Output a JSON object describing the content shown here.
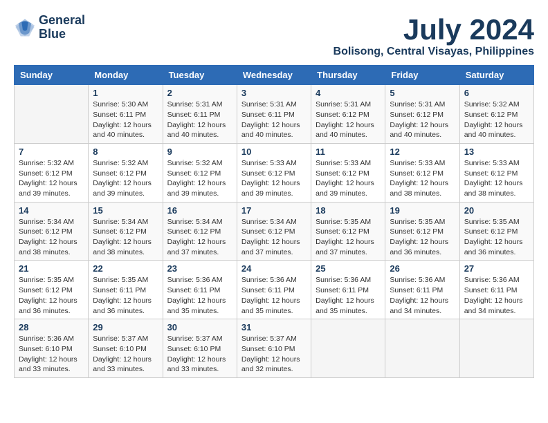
{
  "logo": {
    "line1": "General",
    "line2": "Blue"
  },
  "title": "July 2024",
  "location": "Bolisong, Central Visayas, Philippines",
  "weekdays": [
    "Sunday",
    "Monday",
    "Tuesday",
    "Wednesday",
    "Thursday",
    "Friday",
    "Saturday"
  ],
  "weeks": [
    [
      {
        "day": "",
        "info": ""
      },
      {
        "day": "1",
        "info": "Sunrise: 5:30 AM\nSunset: 6:11 PM\nDaylight: 12 hours\nand 40 minutes."
      },
      {
        "day": "2",
        "info": "Sunrise: 5:31 AM\nSunset: 6:11 PM\nDaylight: 12 hours\nand 40 minutes."
      },
      {
        "day": "3",
        "info": "Sunrise: 5:31 AM\nSunset: 6:11 PM\nDaylight: 12 hours\nand 40 minutes."
      },
      {
        "day": "4",
        "info": "Sunrise: 5:31 AM\nSunset: 6:12 PM\nDaylight: 12 hours\nand 40 minutes."
      },
      {
        "day": "5",
        "info": "Sunrise: 5:31 AM\nSunset: 6:12 PM\nDaylight: 12 hours\nand 40 minutes."
      },
      {
        "day": "6",
        "info": "Sunrise: 5:32 AM\nSunset: 6:12 PM\nDaylight: 12 hours\nand 40 minutes."
      }
    ],
    [
      {
        "day": "7",
        "info": "Sunrise: 5:32 AM\nSunset: 6:12 PM\nDaylight: 12 hours\nand 39 minutes."
      },
      {
        "day": "8",
        "info": "Sunrise: 5:32 AM\nSunset: 6:12 PM\nDaylight: 12 hours\nand 39 minutes."
      },
      {
        "day": "9",
        "info": "Sunrise: 5:32 AM\nSunset: 6:12 PM\nDaylight: 12 hours\nand 39 minutes."
      },
      {
        "day": "10",
        "info": "Sunrise: 5:33 AM\nSunset: 6:12 PM\nDaylight: 12 hours\nand 39 minutes."
      },
      {
        "day": "11",
        "info": "Sunrise: 5:33 AM\nSunset: 6:12 PM\nDaylight: 12 hours\nand 39 minutes."
      },
      {
        "day": "12",
        "info": "Sunrise: 5:33 AM\nSunset: 6:12 PM\nDaylight: 12 hours\nand 38 minutes."
      },
      {
        "day": "13",
        "info": "Sunrise: 5:33 AM\nSunset: 6:12 PM\nDaylight: 12 hours\nand 38 minutes."
      }
    ],
    [
      {
        "day": "14",
        "info": "Sunrise: 5:34 AM\nSunset: 6:12 PM\nDaylight: 12 hours\nand 38 minutes."
      },
      {
        "day": "15",
        "info": "Sunrise: 5:34 AM\nSunset: 6:12 PM\nDaylight: 12 hours\nand 38 minutes."
      },
      {
        "day": "16",
        "info": "Sunrise: 5:34 AM\nSunset: 6:12 PM\nDaylight: 12 hours\nand 37 minutes."
      },
      {
        "day": "17",
        "info": "Sunrise: 5:34 AM\nSunset: 6:12 PM\nDaylight: 12 hours\nand 37 minutes."
      },
      {
        "day": "18",
        "info": "Sunrise: 5:35 AM\nSunset: 6:12 PM\nDaylight: 12 hours\nand 37 minutes."
      },
      {
        "day": "19",
        "info": "Sunrise: 5:35 AM\nSunset: 6:12 PM\nDaylight: 12 hours\nand 36 minutes."
      },
      {
        "day": "20",
        "info": "Sunrise: 5:35 AM\nSunset: 6:12 PM\nDaylight: 12 hours\nand 36 minutes."
      }
    ],
    [
      {
        "day": "21",
        "info": "Sunrise: 5:35 AM\nSunset: 6:12 PM\nDaylight: 12 hours\nand 36 minutes."
      },
      {
        "day": "22",
        "info": "Sunrise: 5:35 AM\nSunset: 6:11 PM\nDaylight: 12 hours\nand 36 minutes."
      },
      {
        "day": "23",
        "info": "Sunrise: 5:36 AM\nSunset: 6:11 PM\nDaylight: 12 hours\nand 35 minutes."
      },
      {
        "day": "24",
        "info": "Sunrise: 5:36 AM\nSunset: 6:11 PM\nDaylight: 12 hours\nand 35 minutes."
      },
      {
        "day": "25",
        "info": "Sunrise: 5:36 AM\nSunset: 6:11 PM\nDaylight: 12 hours\nand 35 minutes."
      },
      {
        "day": "26",
        "info": "Sunrise: 5:36 AM\nSunset: 6:11 PM\nDaylight: 12 hours\nand 34 minutes."
      },
      {
        "day": "27",
        "info": "Sunrise: 5:36 AM\nSunset: 6:11 PM\nDaylight: 12 hours\nand 34 minutes."
      }
    ],
    [
      {
        "day": "28",
        "info": "Sunrise: 5:36 AM\nSunset: 6:10 PM\nDaylight: 12 hours\nand 33 minutes."
      },
      {
        "day": "29",
        "info": "Sunrise: 5:37 AM\nSunset: 6:10 PM\nDaylight: 12 hours\nand 33 minutes."
      },
      {
        "day": "30",
        "info": "Sunrise: 5:37 AM\nSunset: 6:10 PM\nDaylight: 12 hours\nand 33 minutes."
      },
      {
        "day": "31",
        "info": "Sunrise: 5:37 AM\nSunset: 6:10 PM\nDaylight: 12 hours\nand 32 minutes."
      },
      {
        "day": "",
        "info": ""
      },
      {
        "day": "",
        "info": ""
      },
      {
        "day": "",
        "info": ""
      }
    ]
  ]
}
